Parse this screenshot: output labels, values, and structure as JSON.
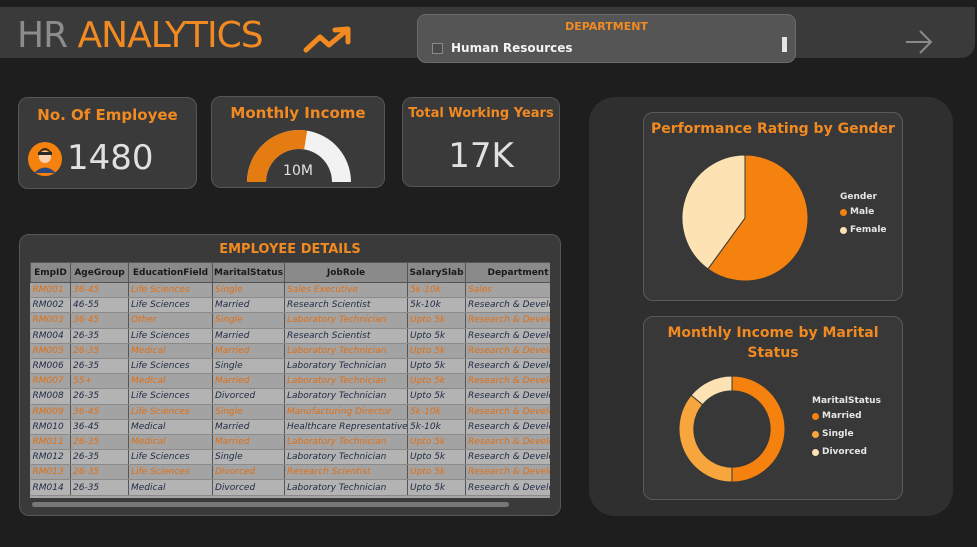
{
  "header": {
    "title_part1": "HR",
    "title_part2": "ANALYTICS",
    "slicer_label": "DEPARTMENT",
    "slicer_value": "Human Resources"
  },
  "kpis": {
    "employees": {
      "title": "No. Of Employee",
      "value": "1480"
    },
    "income": {
      "title": "Monthly Income",
      "value": "10M",
      "fill_fraction": 0.55
    },
    "years": {
      "title": "Total Working Years",
      "value": "17K"
    }
  },
  "details": {
    "title": "EMPLOYEE DETAILS",
    "columns": [
      "EmpID",
      "AgeGroup",
      "EducationField",
      "MaritalStatus",
      "JobRole",
      "SalarySlab",
      "Department"
    ],
    "rows": [
      [
        "RM001",
        "36-45",
        "Life Sciences",
        "Single",
        "Sales Executive",
        "5k-10k",
        "Sales"
      ],
      [
        "RM002",
        "46-55",
        "Life Sciences",
        "Married",
        "Research Scientist",
        "5k-10k",
        "Research & Development"
      ],
      [
        "RM003",
        "36-45",
        "Other",
        "Single",
        "Laboratory Technician",
        "Upto 5k",
        "Research & Development"
      ],
      [
        "RM004",
        "26-35",
        "Life Sciences",
        "Married",
        "Research Scientist",
        "Upto 5k",
        "Research & Development"
      ],
      [
        "RM005",
        "26-35",
        "Medical",
        "Married",
        "Laboratory Technician",
        "Upto 5k",
        "Research & Development"
      ],
      [
        "RM006",
        "26-35",
        "Life Sciences",
        "Single",
        "Laboratory Technician",
        "Upto 5k",
        "Research & Development"
      ],
      [
        "RM007",
        "55+",
        "Medical",
        "Married",
        "Laboratory Technician",
        "Upto 5k",
        "Research & Development"
      ],
      [
        "RM008",
        "26-35",
        "Life Sciences",
        "Divorced",
        "Laboratory Technician",
        "Upto 5k",
        "Research & Development"
      ],
      [
        "RM009",
        "36-45",
        "Life Sciences",
        "Single",
        "Manufacturing Director",
        "5k-10k",
        "Research & Development"
      ],
      [
        "RM010",
        "36-45",
        "Medical",
        "Married",
        "Healthcare Representative",
        "5k-10k",
        "Research & Development"
      ],
      [
        "RM011",
        "26-35",
        "Medical",
        "Married",
        "Laboratory Technician",
        "Upto 5k",
        "Research & Development"
      ],
      [
        "RM012",
        "26-35",
        "Life Sciences",
        "Single",
        "Laboratory Technician",
        "Upto 5k",
        "Research & Development"
      ],
      [
        "RM013",
        "26-35",
        "Life Sciences",
        "Divorced",
        "Research Scientist",
        "Upto 5k",
        "Research & Development"
      ],
      [
        "RM014",
        "26-35",
        "Medical",
        "Divorced",
        "Laboratory Technician",
        "Upto 5k",
        "Research & Development"
      ]
    ]
  },
  "chart_data": [
    {
      "type": "pie",
      "title": "Performance Rating by Gender",
      "legend_title": "Gender",
      "legend_position": "right",
      "categories": [
        "Male",
        "Female"
      ],
      "values": [
        60,
        40
      ],
      "colors": [
        "#f5820f",
        "#fde2b3"
      ]
    },
    {
      "type": "pie",
      "subtype": "donut",
      "title": "Monthly Income by Marital Status",
      "legend_title": "MaritalStatus",
      "legend_position": "right",
      "categories": [
        "Married",
        "Single",
        "Divorced"
      ],
      "values": [
        50,
        36,
        14
      ],
      "colors": [
        "#f5820f",
        "#f6a63c",
        "#fde2b3"
      ]
    }
  ],
  "colors": {
    "accent": "#f28a22",
    "background": "#1e1e1e",
    "card": "#3a3a3a"
  }
}
